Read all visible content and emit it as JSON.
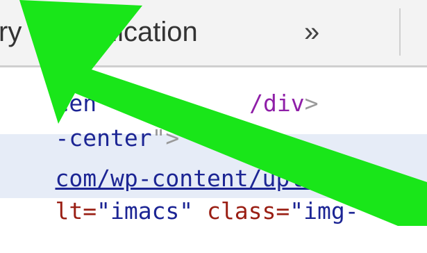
{
  "toolbar": {
    "tab_memory": "ry",
    "tab_application": "plication",
    "overflow_chevron": "»"
  },
  "code": {
    "line1": {
      "prefix": "cen",
      "tag": "/div",
      "suffix": ">"
    },
    "line2": {
      "text": "-center",
      "close": "\">"
    },
    "line3": {
      "link": "com/wp-content/uploads/"
    },
    "line4": {
      "attr_tail": "lt=",
      "value": "\"imacs\"",
      "attr2": "class=",
      "value2": "\"img-"
    }
  },
  "colors": {
    "annotation_arrow": "#19e619",
    "selected_row": "#e6ecf7"
  }
}
